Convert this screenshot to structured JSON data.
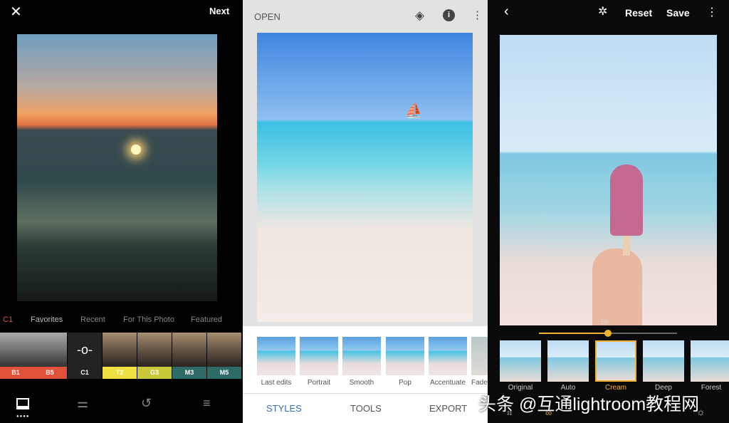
{
  "vsco": {
    "close_icon": "close-icon",
    "next": "Next",
    "tabs": [
      {
        "label": "C1",
        "color": "#e0503a"
      },
      {
        "label": "Favorites"
      },
      {
        "label": "Recent"
      },
      {
        "label": "For This Photo"
      },
      {
        "label": "Featured"
      }
    ],
    "filters": [
      {
        "label": "B1",
        "color": "#e0503a"
      },
      {
        "label": "B5",
        "color": "#e0503a"
      },
      {
        "label": "C1",
        "color": "#222222"
      },
      {
        "label": "T2",
        "color": "#f0e040"
      },
      {
        "label": "G3",
        "color": "#c8c838"
      },
      {
        "label": "M3",
        "color": "#2e6a66"
      },
      {
        "label": "M5",
        "color": "#2e6a66"
      }
    ],
    "bottom_icons": [
      "image-icon",
      "sliders-icon",
      "history-icon",
      "recipes-icon"
    ]
  },
  "snapseed": {
    "open": "OPEN",
    "styles": [
      "Last edits",
      "Portrait",
      "Smooth",
      "Pop",
      "Accentuate",
      "Fade"
    ],
    "tabs": [
      "STYLES",
      "TOOLS",
      "EXPORT"
    ],
    "accent": "#3a6fc0"
  },
  "editor": {
    "reset": "Reset",
    "save": "Save",
    "slider_value": "50",
    "slider_level": 50,
    "filters": [
      "Original",
      "Auto",
      "Cream",
      "Deep",
      "Forest"
    ],
    "selected": "Cream",
    "accent": "#f0b030"
  },
  "watermark": "头条 @互通lightroom教程网"
}
